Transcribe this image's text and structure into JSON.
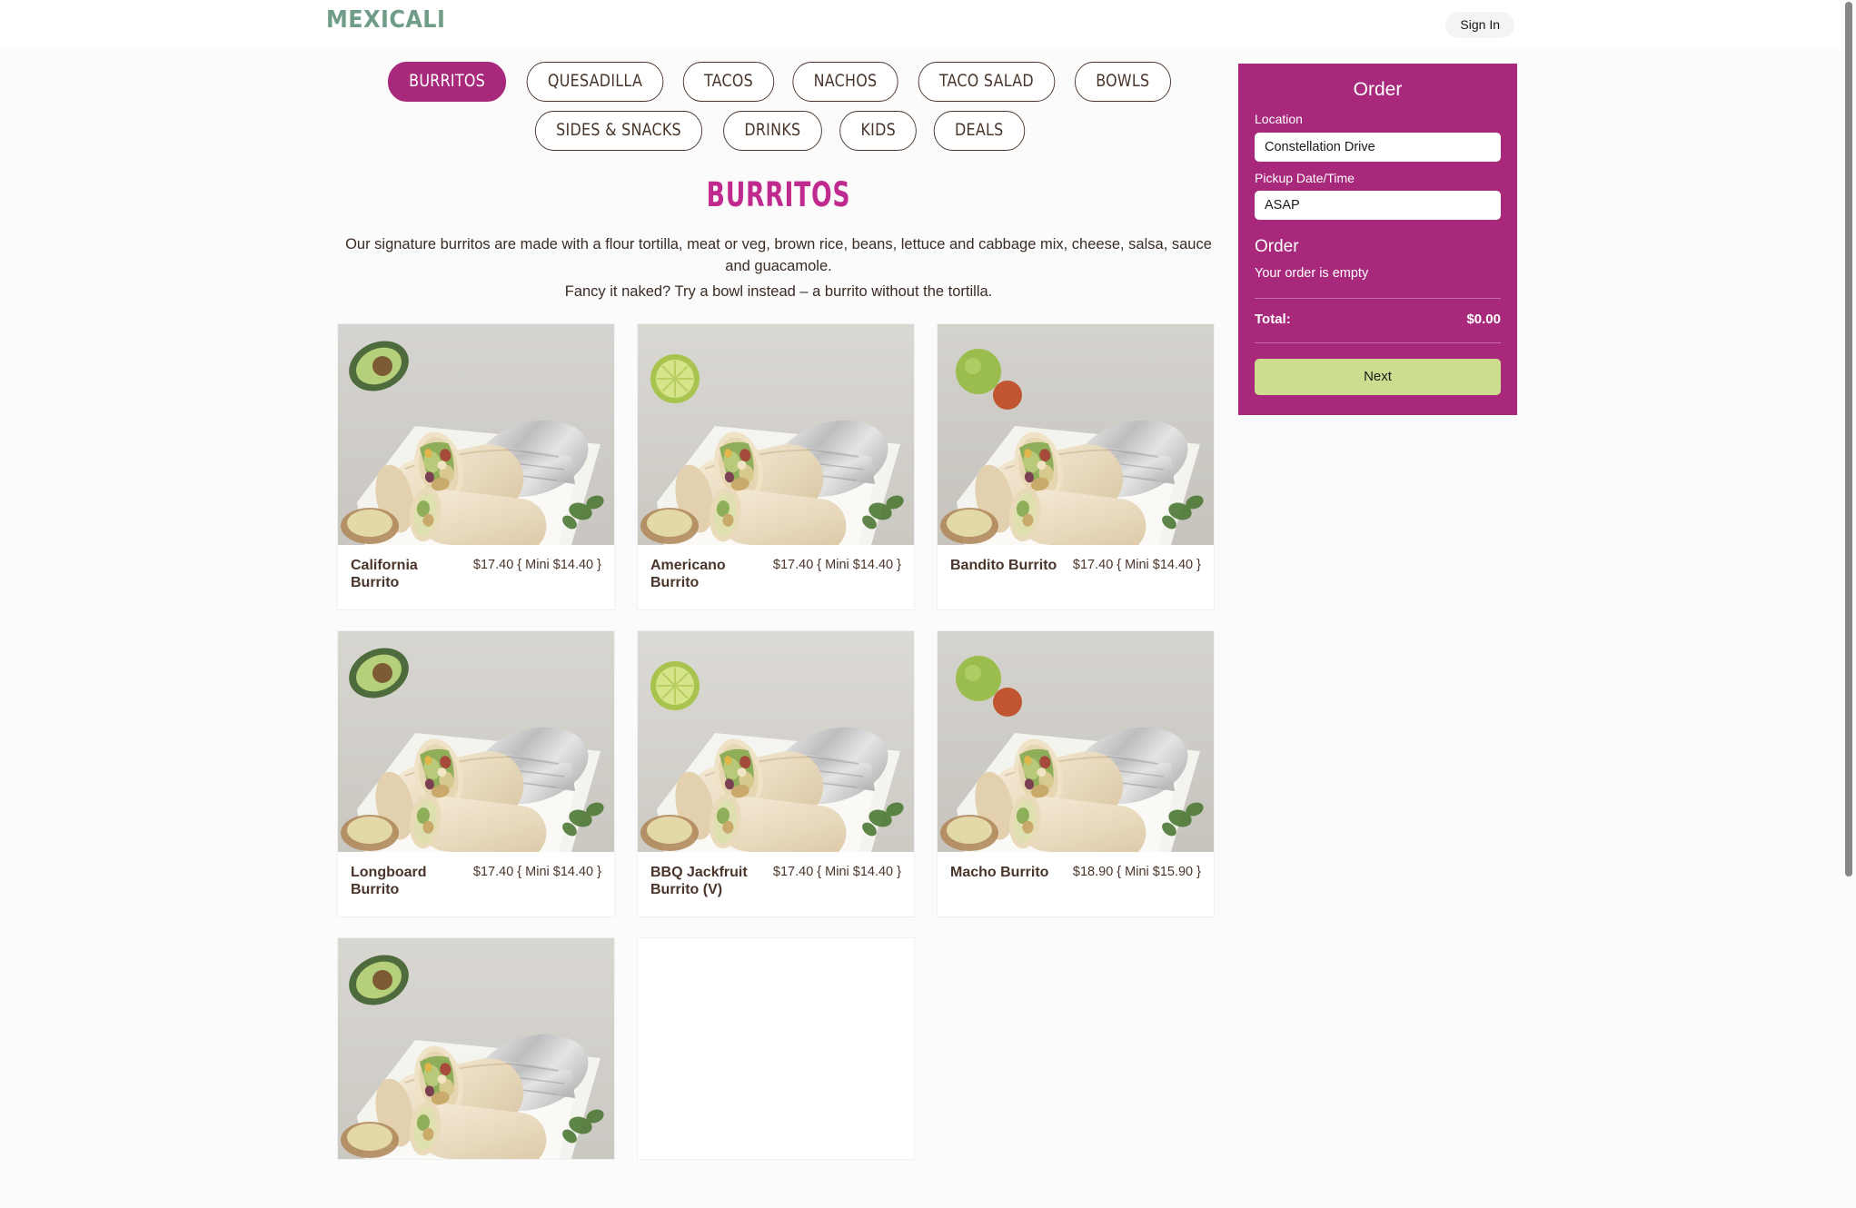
{
  "header": {
    "logo_text": "MEXICALI",
    "logo_color": "#6f9d87",
    "signin_label": "Sign In"
  },
  "nav": {
    "tabs": [
      {
        "label": "BURRITOS",
        "active": true
      },
      {
        "label": "QUESADILLA",
        "active": false
      },
      {
        "label": "TACOS",
        "active": false
      },
      {
        "label": "NACHOS",
        "active": false
      },
      {
        "label": "TACO SALAD",
        "active": false
      },
      {
        "label": "BOWLS",
        "active": false
      },
      {
        "label": "SIDES & SNACKS",
        "active": false
      },
      {
        "label": "DRINKS",
        "active": false
      },
      {
        "label": "KIDS",
        "active": false
      },
      {
        "label": "DEALS",
        "active": false
      }
    ]
  },
  "section": {
    "title": "BURRITOS",
    "title_color": "#c02a8f",
    "description_line1": "Our signature burritos are made with a flour tortilla, meat or veg, brown rice, beans, lettuce and cabbage mix, cheese, salsa, sauce and guacamole.",
    "description_line2": "Fancy it naked? Try a bowl instead – a burrito without the tortilla."
  },
  "products": [
    {
      "name": "California Burrito",
      "price": "$17.40 { Mini $14.40 }",
      "has_image": true
    },
    {
      "name": "Americano Burrito",
      "price": "$17.40 { Mini $14.40 }",
      "has_image": true
    },
    {
      "name": "Bandito Burrito",
      "price": "$17.40 { Mini $14.40 }",
      "has_image": true
    },
    {
      "name": "Longboard Burrito",
      "price": "$17.40 { Mini $14.40 }",
      "has_image": true
    },
    {
      "name": "BBQ Jackfruit Burrito (V)",
      "price": "$17.40 { Mini $14.40 }",
      "has_image": true
    },
    {
      "name": "Macho Burrito",
      "price": "$18.90 { Mini $15.90 }",
      "has_image": true
    },
    {
      "name": "",
      "price": "",
      "has_image": true
    },
    {
      "name": "",
      "price": "",
      "has_image": false
    }
  ],
  "order": {
    "panel_color": "#a8297c",
    "heading": "Order",
    "location_label": "Location",
    "location_value": "Constellation Drive",
    "pickup_label": "Pickup Date/Time",
    "pickup_value": "ASAP",
    "order_subheading": "Order",
    "empty_message": "Your order is empty",
    "total_label": "Total:",
    "total_amount": "$0.00",
    "next_label": "Next",
    "next_color": "#cddd8f"
  }
}
